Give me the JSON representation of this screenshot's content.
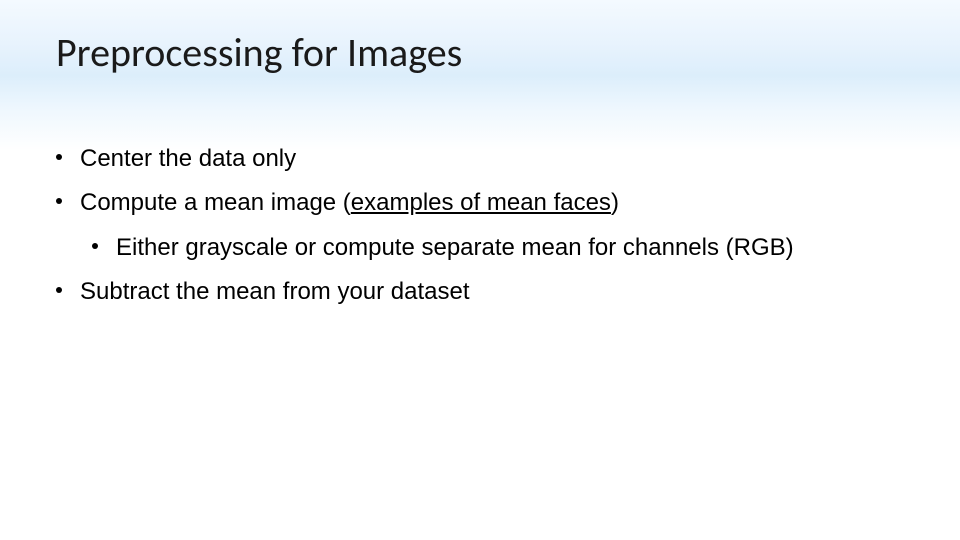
{
  "slide": {
    "title": "Preprocessing for Images",
    "bullets": [
      {
        "level": 1,
        "prefix": "",
        "text": "Center the data only",
        "suffix": ""
      },
      {
        "level": 1,
        "prefix": "Compute a mean image (",
        "text": "examples of mean faces",
        "suffix": ")",
        "link": true
      },
      {
        "level": 2,
        "prefix": "",
        "text": "Either grayscale or compute separate mean for channels (RGB)",
        "suffix": ""
      },
      {
        "level": 1,
        "prefix": "",
        "text": "Subtract the mean from your dataset",
        "suffix": ""
      }
    ]
  }
}
